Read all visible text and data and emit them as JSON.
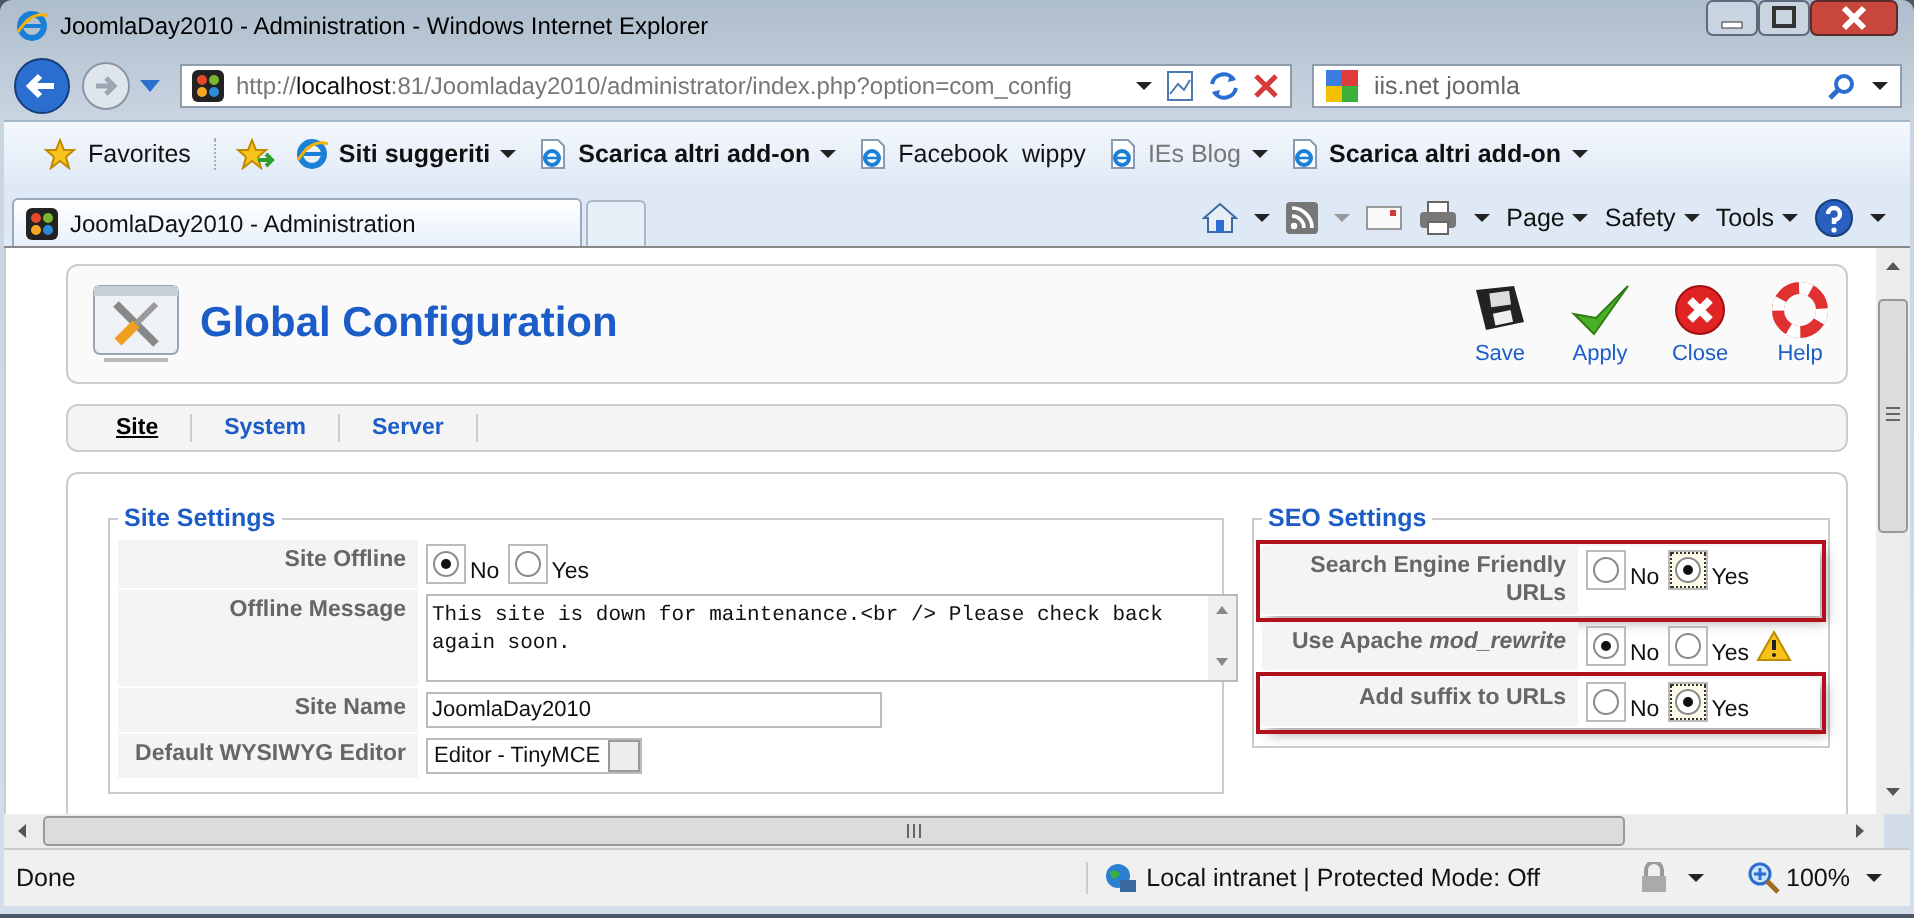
{
  "window": {
    "title": "JoomlaDay2010 - Administration - Windows Internet Explorer"
  },
  "address_bar": {
    "url": "http://**localhost**:81/Joomladay2010/administrator/index.php?option=com_config"
  },
  "search": {
    "value": "iis.net joomla"
  },
  "favorites_bar": {
    "label": "Favorites",
    "items": [
      {
        "label": "Siti suggeriti",
        "bold": true,
        "dimmed": false,
        "dropdown": true
      },
      {
        "label": "Scarica altri add-on",
        "bold": true,
        "dimmed": false,
        "dropdown": true
      },
      {
        "label": "Facebook  wippy",
        "bold": false,
        "dimmed": false,
        "dropdown": false
      },
      {
        "label": "IEs Blog",
        "bold": false,
        "dimmed": true,
        "dropdown": true
      },
      {
        "label": "Scarica altri add-on",
        "bold": true,
        "dimmed": false,
        "dropdown": true
      }
    ]
  },
  "tabs": [
    {
      "label": "JoomlaDay2010 - Administration",
      "selected": true
    }
  ],
  "command_bar": {
    "menus": [
      "Page",
      "Safety",
      "Tools"
    ]
  },
  "page": {
    "title": "Global Configuration",
    "toolbar": [
      {
        "label": "Save",
        "kind": "save"
      },
      {
        "label": "Apply",
        "kind": "apply"
      },
      {
        "label": "Close",
        "kind": "close"
      },
      {
        "label": "Help",
        "kind": "help"
      }
    ],
    "tabs": [
      {
        "label": "Site",
        "selected": true
      },
      {
        "label": "System",
        "selected": false
      },
      {
        "label": "Server",
        "selected": false
      }
    ],
    "site_settings": {
      "legend": "Site Settings",
      "fields": [
        {
          "label": "Site Offline",
          "kind": "radio",
          "options": [
            {
              "label": "No",
              "selected": true
            },
            {
              "label": "Yes",
              "selected": false
            }
          ]
        },
        {
          "label": "Offline Message",
          "kind": "textarea",
          "value": "This site is down for maintenance.<br /> Please check back again soon."
        },
        {
          "label": "Site Name",
          "kind": "text",
          "value": "JoomlaDay2010"
        },
        {
          "label": "Default WYSIWYG Editor",
          "kind": "select",
          "value": "Editor - TinyMCE"
        }
      ]
    },
    "seo_settings": {
      "legend": "SEO Settings",
      "fields": [
        {
          "label": "Search Engine Friendly URLs",
          "kind": "radio",
          "highlighted": true,
          "warning": false,
          "options": [
            {
              "label": "No",
              "selected": false
            },
            {
              "label": "Yes",
              "selected": true
            }
          ]
        },
        {
          "label": "Use Apache *mod_rewrite*",
          "kind": "radio",
          "highlighted": false,
          "warning": true,
          "options": [
            {
              "label": "No",
              "selected": true
            },
            {
              "label": "Yes",
              "selected": false
            }
          ]
        },
        {
          "label": "Add suffix to URLs",
          "kind": "radio",
          "highlighted": true,
          "warning": false,
          "options": [
            {
              "label": "No",
              "selected": false
            },
            {
              "label": "Yes",
              "selected": true
            }
          ]
        }
      ]
    }
  },
  "status_bar": {
    "text": "Done",
    "zone": "Local intranet | Protected Mode: Off",
    "zoom": "100%"
  }
}
